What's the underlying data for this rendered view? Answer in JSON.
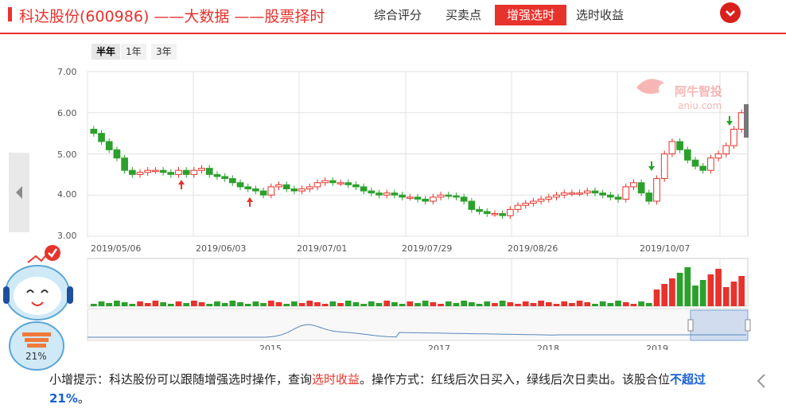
{
  "header": {
    "title": "科达股份(600986) ——大数据 ——股票择时",
    "tabs": [
      {
        "label": "综合评分"
      },
      {
        "label": "买卖点"
      },
      {
        "label": "增强选时"
      },
      {
        "label": "选时收益"
      }
    ]
  },
  "range": {
    "buttons": [
      "半年",
      "1年",
      "3年"
    ]
  },
  "chart_data": {
    "type": "candlestick",
    "y_ticks": [
      "7.00",
      "6.00",
      "5.00",
      "4.00",
      "3.00"
    ],
    "ylim": [
      3,
      7
    ],
    "x_ticks": [
      "2019/05/06",
      "2019/06/03",
      "2019/07/01",
      "2019/07/29",
      "2019/08/26",
      "2019/10/07"
    ],
    "overview_ticks": [
      "2015",
      "2017",
      "2018",
      "2019"
    ],
    "close_series": [
      5.5,
      5.3,
      5.1,
      4.9,
      4.6,
      4.5,
      4.55,
      4.6,
      4.6,
      4.55,
      4.5,
      4.6,
      4.5,
      4.6,
      4.65,
      4.5,
      4.45,
      4.4,
      4.3,
      4.2,
      4.15,
      4.1,
      4.0,
      4.2,
      4.25,
      4.15,
      4.1,
      4.15,
      4.2,
      4.3,
      4.35,
      4.3,
      4.3,
      4.25,
      4.2,
      4.1,
      4.05,
      4.0,
      4.05,
      4.0,
      3.95,
      3.95,
      3.9,
      3.85,
      3.95,
      4.0,
      3.98,
      3.95,
      3.85,
      3.65,
      3.6,
      3.55,
      3.55,
      3.5,
      3.65,
      3.75,
      3.8,
      3.85,
      3.9,
      3.95,
      4.0,
      4.05,
      4.05,
      4.05,
      4.1,
      4.05,
      4.0,
      3.95,
      3.9,
      4.2,
      4.3,
      4.05,
      3.85,
      4.4,
      5.0,
      5.3,
      5.1,
      4.85,
      4.7,
      4.6,
      4.9,
      5.0,
      5.2,
      5.6,
      6.0
    ],
    "watermark": "阿牛智投",
    "watermark_url": "aniu.com"
  },
  "colors": {
    "up": "#e8322c",
    "down": "#2ca02c",
    "accent": "#e8322c",
    "grid": "#e2e2e2"
  },
  "mascot": {
    "percent": "21%"
  },
  "tip": {
    "prefix": "小增提示：科达股份可以跟随增强选时操作，查询",
    "link": "选时收益",
    "middle": "。操作方式：红线后次日买入，绿线后次日卖出。该股合位",
    "emph1": "不超过",
    "emph2": "21%",
    "suffix": "。"
  },
  "icons": {
    "left": "chevron-left-icon",
    "right": "chevron-right-icon",
    "collapse": "chevron-down-icon"
  }
}
